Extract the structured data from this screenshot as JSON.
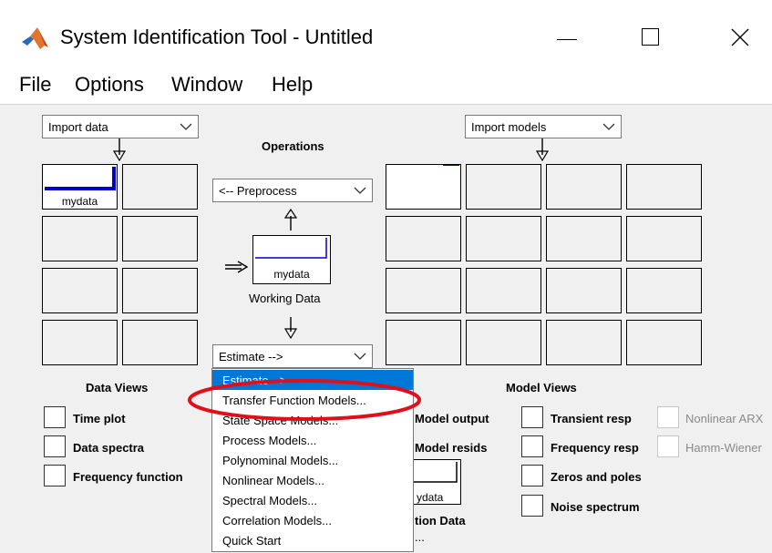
{
  "window": {
    "title": "System Identification Tool - Untitled",
    "minimize_glyph": "—",
    "maximize_glyph": "☐",
    "close_glyph": "✕"
  },
  "menu": [
    "File",
    "Options",
    "Window",
    "Help"
  ],
  "data_panel": {
    "import_select": "Import data",
    "tile_label": "mydata",
    "views_title": "Data Views",
    "views": [
      "Time plot",
      "Data spectra",
      "Frequency function"
    ]
  },
  "operations": {
    "title": "Operations",
    "preprocess_select": "<-- Preprocess",
    "working_data_label": "mydata",
    "working_data_caption": "Working Data",
    "estimate_select": "Estimate -->",
    "arrow_up": "⇧",
    "arrow_down": "⇩",
    "arrow_right": "⇒"
  },
  "estimate_menu": {
    "items": [
      "Estimate -->",
      "Transfer Function Models...",
      "State Space Models...",
      "Process Models...",
      "Polynominal Models...",
      "Nonlinear Models...",
      "Spectral Models...",
      "Correlation Models...",
      "Quick Start"
    ],
    "selected_index": 0
  },
  "behind_menu": {
    "model_output": "Model output",
    "model_resids": "Model resids",
    "validation_tile_label": "ydata",
    "validation_caption": "tion Data",
    "validation_caption_2": "..."
  },
  "model_panel": {
    "import_select": "Import models",
    "views_title": "Model Views",
    "views_col1": [
      "Transient resp",
      "Frequency resp",
      "Zeros and poles",
      "Noise spectrum"
    ],
    "views_col2": [
      "Nonlinear ARX",
      "Hamm-Wiener"
    ]
  },
  "colors": {
    "selection": "#0078d7",
    "plot_line": "#0000cc",
    "annotation": "#e0101a",
    "panel_bg": "#f0f0f0"
  }
}
